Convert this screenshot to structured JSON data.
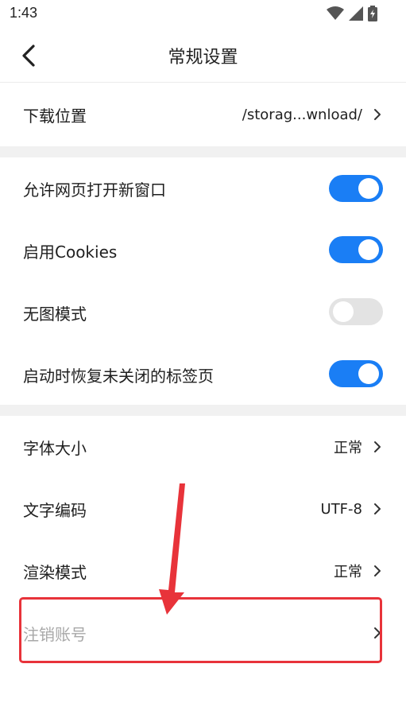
{
  "status_bar": {
    "time": "1:43"
  },
  "header": {
    "title": "常规设置",
    "back_icon": "chevron-left-icon"
  },
  "download": {
    "label": "下载位置",
    "value": "/storag...wnload/"
  },
  "toggles": [
    {
      "label": "允许网页打开新窗口",
      "on": true
    },
    {
      "label": "启用Cookies",
      "on": true
    },
    {
      "label": "无图模式",
      "on": false
    },
    {
      "label": "启动时恢复未关闭的标签页",
      "on": true
    }
  ],
  "options": [
    {
      "label": "字体大小",
      "value": "正常"
    },
    {
      "label": "文字编码",
      "value": "UTF-8"
    },
    {
      "label": "渲染模式",
      "value": "正常"
    }
  ],
  "logout": {
    "label": "注销账号"
  },
  "colors": {
    "accent": "#1a7ef5",
    "toggle_off": "#e3e3e3",
    "annotation": "#e8333a",
    "section_gap": "#f1f1f1"
  }
}
